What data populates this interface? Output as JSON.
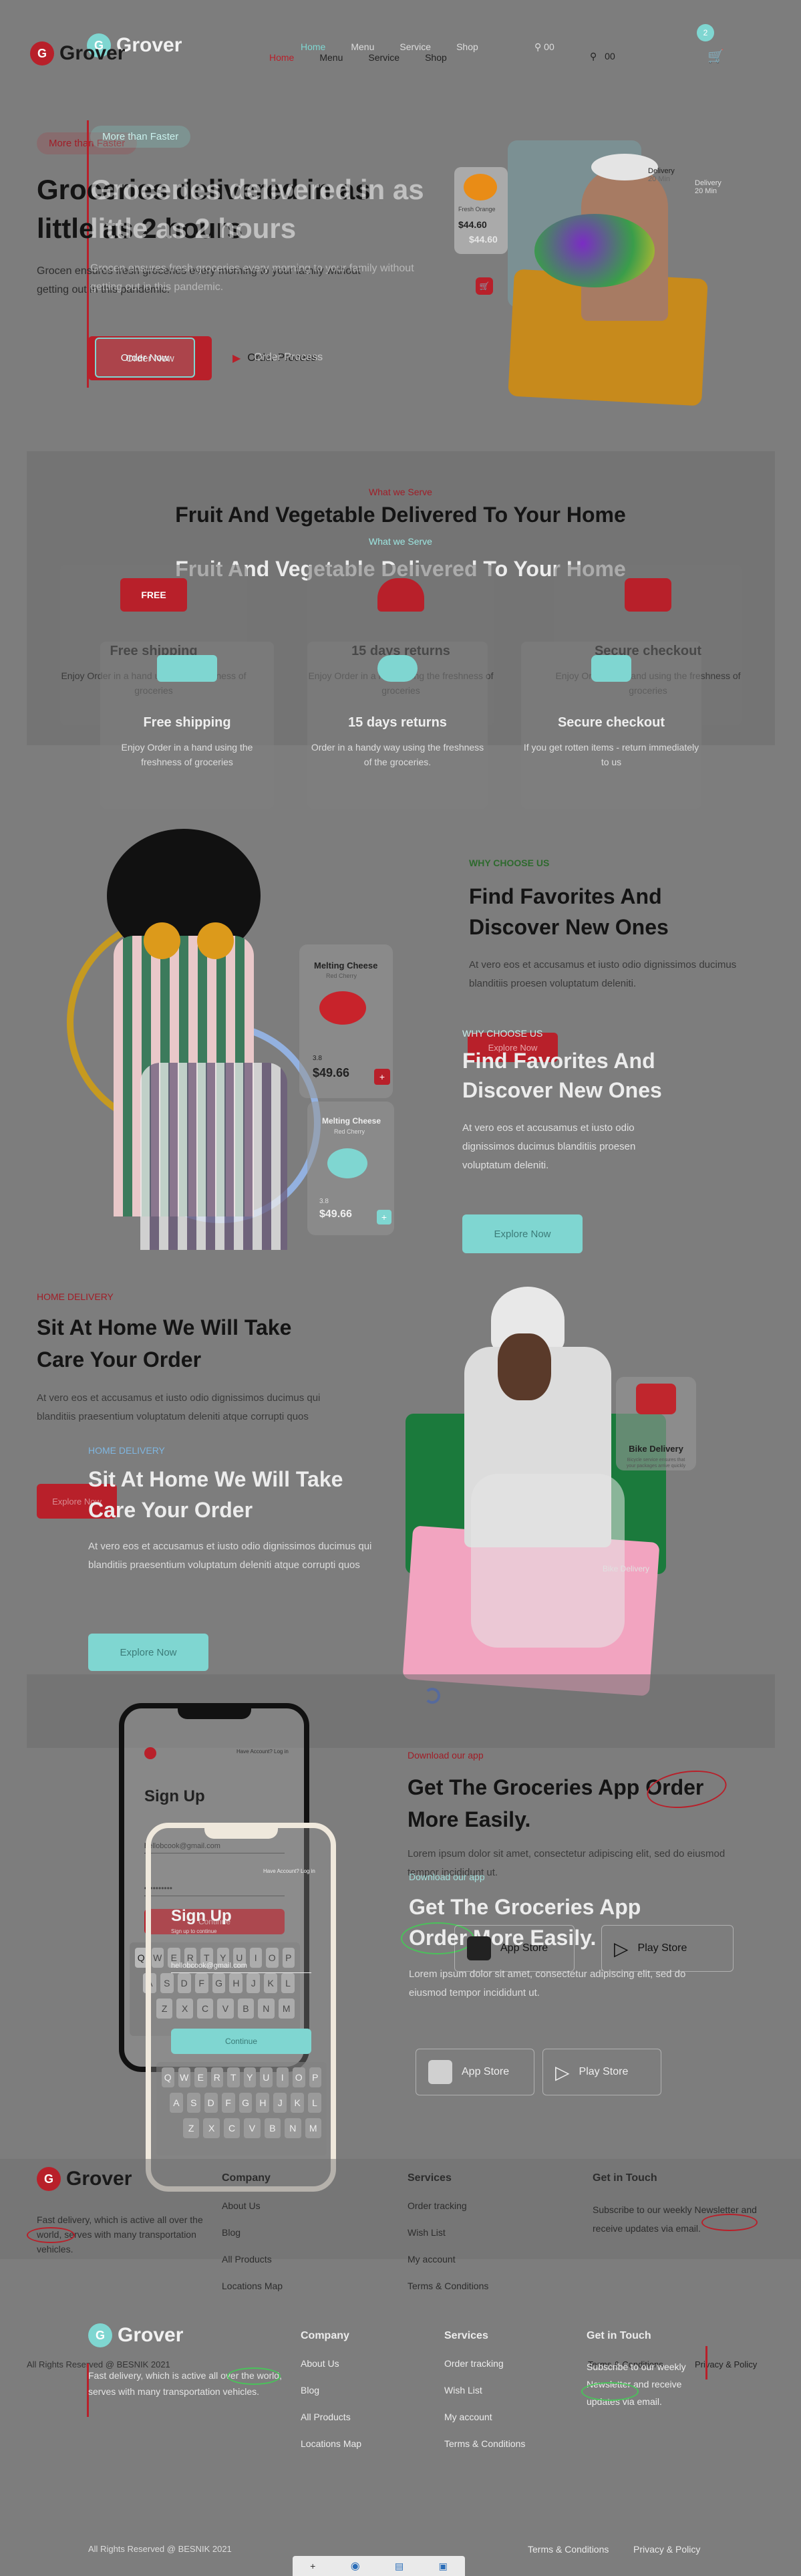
{
  "colors": {
    "brand_red": "#b8202a",
    "brand_teal": "#7fd6d1",
    "bg_gray": "#7d7d7d"
  },
  "brand": {
    "name": "Grover",
    "logo_letter": "G"
  },
  "nav": {
    "primary": [
      "Home",
      "Menu",
      "Service",
      "Shop"
    ],
    "ghost": [
      "Home",
      "Menu",
      "Service",
      "Shop"
    ],
    "search_count": "00",
    "search_count_ghost": "00",
    "cart_badge": "2"
  },
  "hero": {
    "tag": "More than Faster",
    "tag_ghost": "More than Faster",
    "title_line1": "Groceries delivered in as",
    "title_line2": "little as 2 hours",
    "title_line1_ghost": "Groceries delivered in as",
    "title_line2_ghost": "little as 2 hours",
    "desc": "Grocen ensures fresh groceries every morning to your family without getting out in this pandemic.",
    "desc_ghost": "Grocen ensures fresh groceries every morning to your family without getting out in this pandemic.",
    "order_btn": "Order Now",
    "order_btn_ghost": "Order Now",
    "process_link": "Order Process",
    "process_link_ghost": "Order Process",
    "product_card": {
      "badge": "Fresh Orange",
      "price": "$44.60",
      "price_ghost": "$44.60"
    },
    "delivery": {
      "label": "Delivery",
      "sub": "20 Min",
      "label_ghost": "Delivery",
      "sub_ghost": "20 Min"
    }
  },
  "services": {
    "eyebrow": "What we Serve",
    "title": "Fruit And Vegetable Delivered To Your Home",
    "eyebrow_ghost": "What we Serve",
    "title_ghost": "Fruit And Vegetable Delivered To Your Home",
    "cards": [
      {
        "title": "Free shipping",
        "desc": "Enjoy Order in a hand using the freshness of groceries",
        "icon": "truck-icon"
      },
      {
        "title": "15 days returns",
        "desc": "Enjoy Order in a hand using the freshness of groceries",
        "icon": "money-hand-icon"
      },
      {
        "title": "Secure checkout",
        "desc": "Enjoy Order in a hand using the freshness of groceries",
        "icon": "chat-checkout-icon"
      }
    ],
    "cards_ghost": [
      {
        "title": "Free shipping",
        "desc": "Enjoy Order in a hand using the freshness of groceries"
      },
      {
        "title": "15 days returns",
        "desc": "Order in a handy way using the freshness of the groceries."
      },
      {
        "title": "Secure checkout",
        "desc": "If you get rotten items - return immediately to us"
      }
    ],
    "truck_label": "FREE"
  },
  "favorites": {
    "eyebrow": "WHY CHOOSE US",
    "title_line1": "Find Favorites And",
    "title_line2": "Discover New Ones",
    "desc": "At vero eos et accusamus et iusto odio dignissimos ducimus blanditiis proesen voluptatum deleniti.",
    "eyebrow_ghost": "WHY CHOOSE US",
    "title_line1_ghost": "Find Favorites And",
    "title_line2_ghost": "Discover New Ones",
    "desc_ghost": "At vero eos et accusamus et iusto odio dignissimos ducimus blanditiis proesen voluptatum deleniti.",
    "explore_btn": "Explore Now",
    "explore_btn_ghost": "Explore Now",
    "product": {
      "name": "Melting Cheese",
      "sub": "Red Cherry",
      "rating": "3.8",
      "price": "$49.66"
    },
    "product_ghost": {
      "name": "Melting Cheese",
      "sub": "Red Cherry",
      "rating": "3.8",
      "price": "$49.66"
    }
  },
  "home_delivery": {
    "eyebrow": "HOME DELIVERY",
    "title_line1": "Sit At Home We Will Take",
    "title_line2": "Care Your Order",
    "desc": "At vero eos et accusamus et iusto odio dignissimos ducimus qui blanditiis praesentium voluptatum deleniti atque corrupti quos",
    "explore_btn": "Explore Now",
    "eyebrow_ghost": "HOME DELIVERY",
    "title_line1_ghost": "Sit At Home We Will Take",
    "title_line2_ghost": "Care Your Order",
    "desc_ghost": "At vero eos et accusamus et iusto odio dignissimos ducimus qui blanditiis praesentium voluptatum deleniti atque corrupti quos",
    "explore_btn_ghost": "Explore Now",
    "bike": {
      "title": "Bike Delivery",
      "desc": "Bicycle service ensures that your packages arrive quickly",
      "title_ghost": "Bike Delivery"
    }
  },
  "app": {
    "eyebrow": "Download our app",
    "title_line1": "Get The Groceries App Order",
    "title_line2": "More Easily.",
    "desc": "Lorem ipsum dolor sit amet, consectetur adipiscing elit, sed do eiusmod tempor incididunt ut.",
    "eyebrow_ghost": "Download our app",
    "title_line1_ghost": "Get The Groceries App",
    "title_line2_ghost": "Order More Easily.",
    "desc_ghost": "Lorem ipsum dolor sit amet, consectetur adipiscing elit, sed do eiusmod tempor incididunt ut.",
    "app_store": "App Store",
    "play_store": "Play Store",
    "app_store_ghost": "App Store",
    "play_store_ghost": "Play Store",
    "phone": {
      "title": "Sign Up",
      "link": "Have Account? Log in",
      "email": "hellobcook@gmail.com",
      "password": "••••••••••",
      "continue": "Continue",
      "title_ghost": "Sign Up",
      "link_ghost": "Have Account? Log in",
      "sub_ghost": "Sign up to continue",
      "email_ghost": "hellobcook@gmail.com",
      "continue_ghost": "Continue",
      "keys": [
        [
          "Q",
          "W",
          "E",
          "R",
          "T",
          "Y",
          "U",
          "I",
          "O",
          "P"
        ],
        [
          "A",
          "S",
          "D",
          "F",
          "G",
          "H",
          "J",
          "K",
          "L"
        ],
        [
          "Z",
          "X",
          "C",
          "V",
          "B",
          "N",
          "M"
        ]
      ]
    }
  },
  "footer": {
    "desc": "Fast delivery, which is active all over the world, serves with many transportation vehicles.",
    "desc_ghost": "Fast delivery, which is active all over the world, serves with many transportation vehicles.",
    "company_title": "Company",
    "company_links": [
      "About Us",
      "Blog",
      "All Products",
      "Locations Map"
    ],
    "services_title": "Services",
    "services_links": [
      "Order tracking",
      "Wish List",
      "My account",
      "Terms & Conditions"
    ],
    "touch_title": "Get in Touch",
    "touch_text": "Subscribe to our weekly Newsletter and receive updates via email.",
    "company_title_ghost": "Company",
    "company_links_ghost": [
      "About Us",
      "Blog",
      "All Products",
      "Locations Map"
    ],
    "services_title_ghost": "Services",
    "services_links_ghost": [
      "Order tracking",
      "Wish List",
      "My account",
      "Terms & Conditions"
    ],
    "touch_title_ghost": "Get in Touch",
    "touch_text_ghost": "Subscribe to our weekly Newsletter and receive updates via email.",
    "copyright": "All Rights Reserved @ BESNIK 2021",
    "copyright_ghost": "All Rights Reserved @ BESNIK 2021",
    "terms": "Terms & Conditions",
    "privacy": "Privacy & Policy",
    "terms_ghost": "Terms & Conditions",
    "privacy_ghost": "Privacy & Policy"
  },
  "toolbar": [
    "+",
    "eye-icon",
    "lock-icon",
    "layers-icon"
  ]
}
